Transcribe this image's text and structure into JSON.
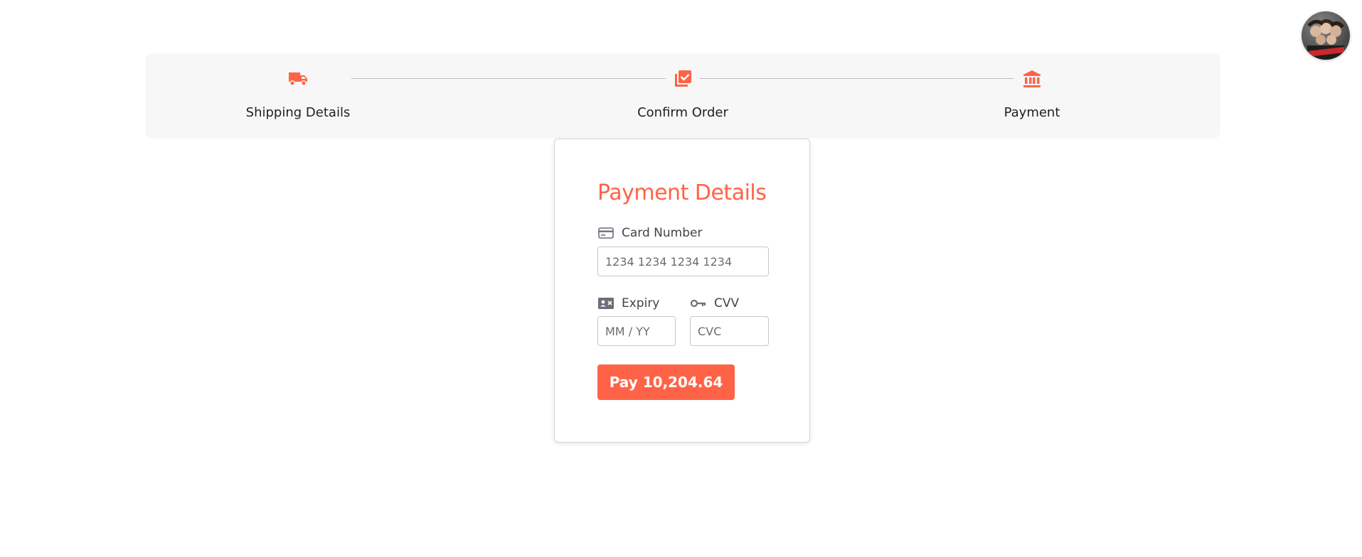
{
  "stepper": {
    "steps": [
      {
        "label": "Shipping Details",
        "icon": "truck-icon",
        "active": true
      },
      {
        "label": "Confirm Order",
        "icon": "library-add-check-icon",
        "active": true
      },
      {
        "label": "Payment",
        "icon": "bank-icon",
        "active": true
      }
    ]
  },
  "payment": {
    "title": "Payment Details",
    "card_number": {
      "label": "Card Number",
      "placeholder": "1234 1234 1234 1234",
      "value": "",
      "icon": "credit-card-icon"
    },
    "expiry": {
      "label": "Expiry",
      "placeholder": "MM / YY",
      "value": "",
      "icon": "event-card-icon"
    },
    "cvv": {
      "label": "CVV",
      "placeholder": "CVC",
      "value": "",
      "icon": "key-icon"
    },
    "pay_button": "Pay 10,204.64"
  },
  "colors": {
    "accent": "#ff6347",
    "stepper_bg": "#f7f7f7",
    "icon_gray": "#6b6f7a"
  }
}
